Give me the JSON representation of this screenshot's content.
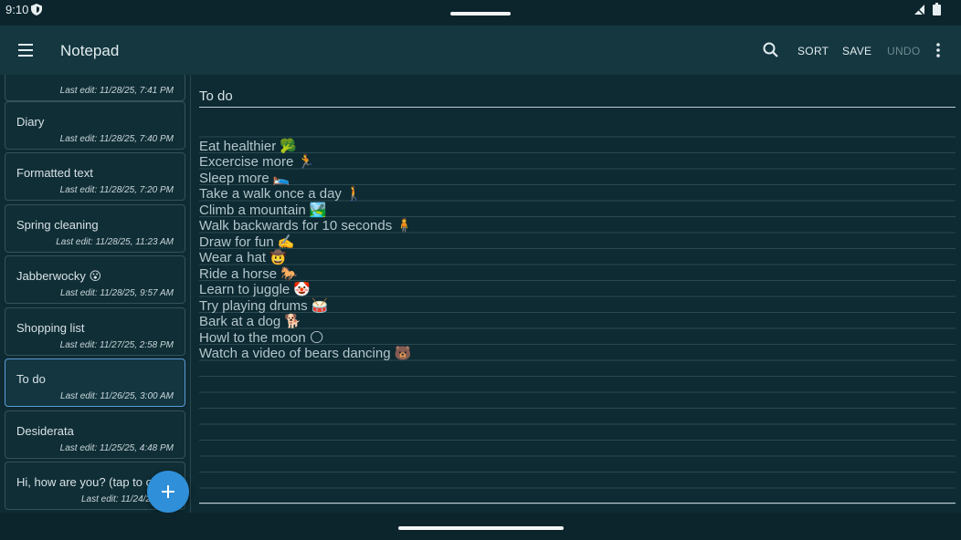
{
  "status_bar": {
    "time": "9:10"
  },
  "app_bar": {
    "title": "Notepad",
    "actions": {
      "sort": "SORT",
      "save": "SAVE",
      "undo": "UNDO"
    }
  },
  "notes": [
    {
      "title": "",
      "date": "Last edit: 11/28/25, 7:41 PM"
    },
    {
      "title": "Diary",
      "date": "Last edit: 11/28/25, 7:40 PM"
    },
    {
      "title": "Formatted text",
      "date": "Last edit: 11/28/25, 7:20 PM"
    },
    {
      "title": "Spring cleaning",
      "date": "Last edit: 11/28/25, 11:23 AM"
    },
    {
      "title": "Jabberwocky 😮",
      "date": "Last edit: 11/28/25, 9:57 AM"
    },
    {
      "title": "Shopping list",
      "date": "Last edit: 11/27/25, 2:58 PM"
    },
    {
      "title": "To do",
      "date": "Last edit: 11/26/25, 3:00 AM"
    },
    {
      "title": "Desiderata",
      "date": "Last edit: 11/25/25, 4:48 PM"
    },
    {
      "title": "Hi, how are you? (tap to o",
      "date": "Last edit: 11/24/25, 10:"
    }
  ],
  "editor": {
    "title": "To do",
    "lines": [
      "",
      "Eat healthier 🥦",
      "Excercise more 🏃",
      "Sleep more 🛌",
      "Take a walk once a day 🚶",
      "Climb a mountain 🏞️",
      "Walk backwards for 10 seconds 🧍",
      "Draw for fun ✍️",
      "Wear a hat 🤠",
      "Ride a horse 🐎",
      "Learn to juggle 🤡",
      "Try playing drums 🥁",
      "Bark at a dog 🐕",
      "Howl to the moon 🌕",
      "Watch a video of bears dancing 🐻"
    ]
  },
  "fab": {
    "label": "+"
  },
  "colors": {
    "accent": "#2f8fd8",
    "selected_border": "#5b9bd5",
    "app_bar": "#143740",
    "background": "#0e2a32"
  },
  "icons": [
    "shield-icon",
    "signal-icon",
    "battery-icon",
    "menu-icon",
    "search-icon",
    "more-vert-icon",
    "add-icon"
  ]
}
